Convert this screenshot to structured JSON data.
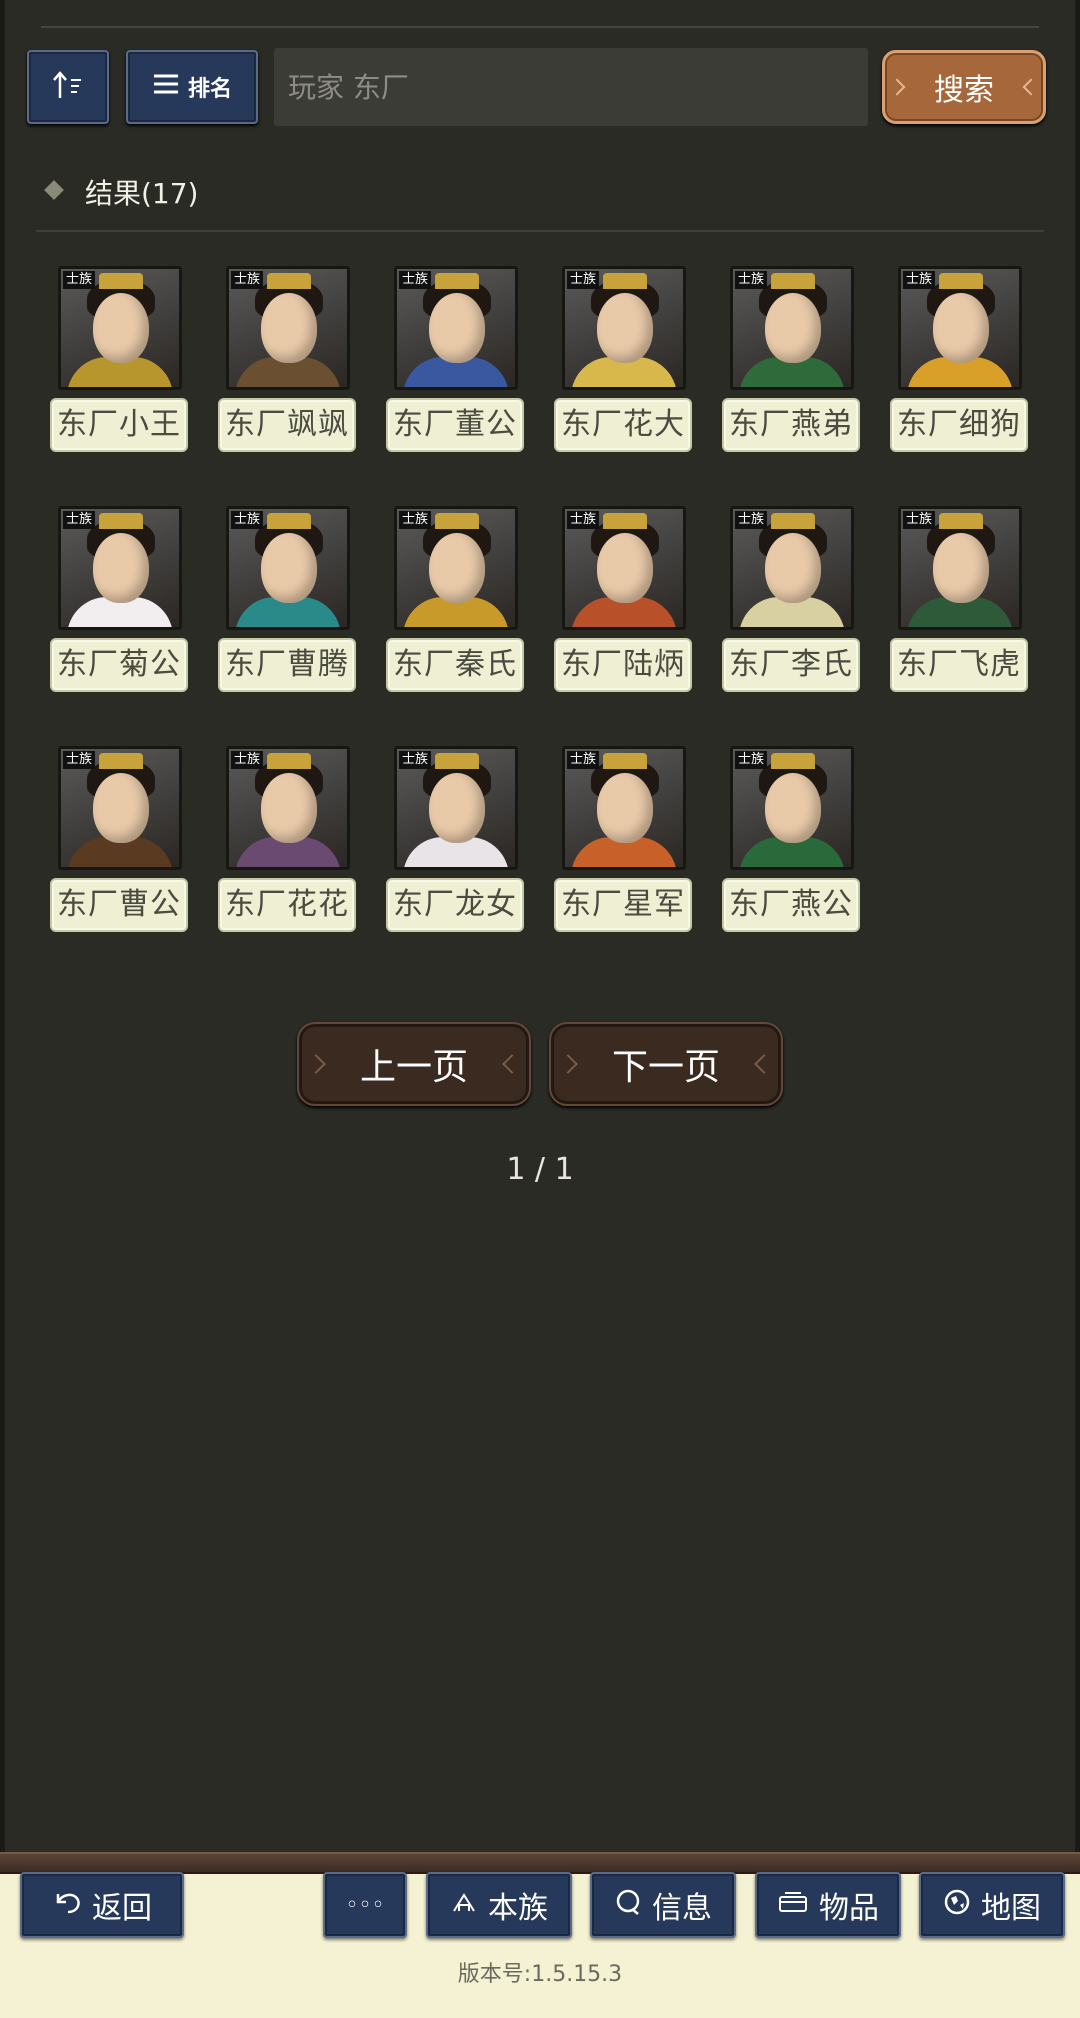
{
  "toolbar": {
    "sort_icon": "sort-ascending-icon",
    "rank_label": "排名",
    "search_placeholder": "玩家 东厂",
    "search_label": "搜索"
  },
  "results": {
    "label": "结果(17)",
    "tag_text": "士族",
    "items": [
      {
        "name": "东厂小王",
        "robe": "#b8962e"
      },
      {
        "name": "东厂飒飒",
        "robe": "#6a5030"
      },
      {
        "name": "东厂董公",
        "robe": "#3a58a0"
      },
      {
        "name": "东厂花大",
        "robe": "#d8b84a"
      },
      {
        "name": "东厂燕弟",
        "robe": "#2f6a3a"
      },
      {
        "name": "东厂细狗",
        "robe": "#d8a028"
      },
      {
        "name": "东厂菊公",
        "robe": "#f2eef0"
      },
      {
        "name": "东厂曹腾",
        "robe": "#2a8a8a"
      },
      {
        "name": "东厂秦氏",
        "robe": "#c89a2a"
      },
      {
        "name": "东厂陆炳",
        "robe": "#b8502a"
      },
      {
        "name": "东厂李氏",
        "robe": "#d8d0a0"
      },
      {
        "name": "东厂飞虎",
        "robe": "#2f5a3a"
      },
      {
        "name": "东厂曹公",
        "robe": "#5a3a20"
      },
      {
        "name": "东厂花花",
        "robe": "#6a4a70"
      },
      {
        "name": "东厂龙女",
        "robe": "#e8e4e8"
      },
      {
        "name": "东厂星军",
        "robe": "#c8602a"
      },
      {
        "name": "东厂燕公",
        "robe": "#2a6a3a"
      }
    ]
  },
  "pagination": {
    "prev_label": "上一页",
    "next_label": "下一页",
    "indicator": "1 / 1"
  },
  "bottom_nav": {
    "back_label": "返回",
    "more_label": "◦◦◦",
    "clan_label": "本族",
    "info_label": "信息",
    "items_label": "物品",
    "map_label": "地图"
  },
  "version": "版本号:1.5.15.3"
}
